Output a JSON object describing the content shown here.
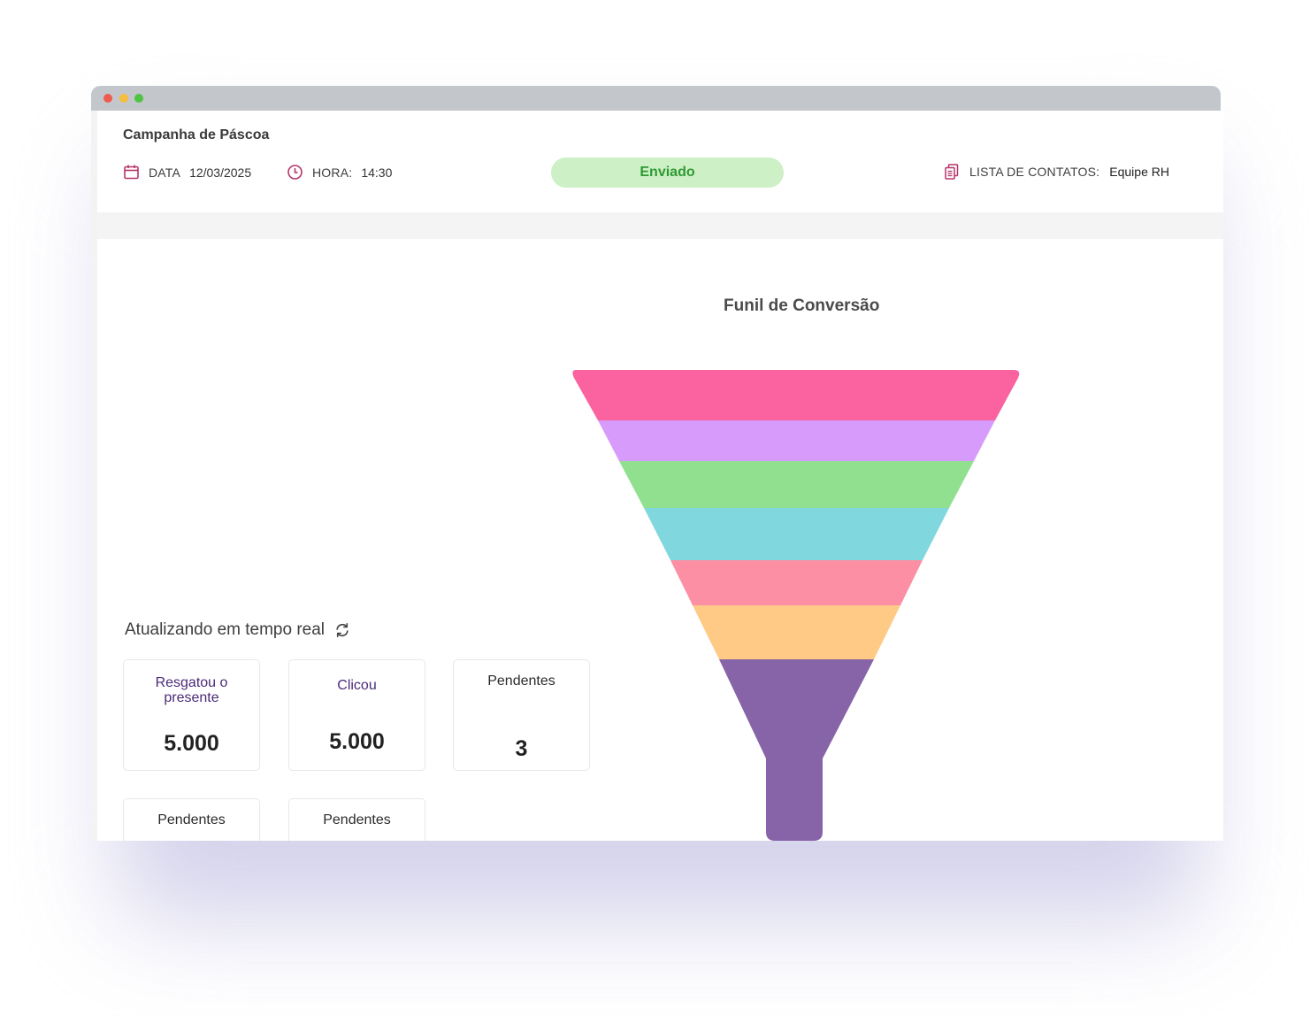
{
  "header": {
    "campaign_title": "Campanha de Páscoa",
    "date_label": "DATA",
    "date_value": "12/03/2025",
    "time_label": "HORA:",
    "time_value": "14:30",
    "status": "Enviado",
    "contacts_label": "LISTA DE CONTATOS:",
    "contacts_value": "Equipe RH"
  },
  "funnel": {
    "title": "Funil de Conversão",
    "stage_colors": [
      "#fb62a0",
      "#d79cfb",
      "#91e090",
      "#80d8de",
      "#fd8fa4",
      "#feca86",
      "#8764a8"
    ]
  },
  "realtime": {
    "label": "Atualizando em tempo real"
  },
  "cards": [
    {
      "label": "Resgatou o presente",
      "value": "5.000"
    },
    {
      "label": "Clicou",
      "value": "5.000"
    },
    {
      "label": "Pendentes",
      "value": "3"
    },
    {
      "label": "Pendentes",
      "value": ""
    },
    {
      "label": "Pendentes",
      "value": ""
    }
  ],
  "colors": {
    "accent": "#b5356b",
    "status_bg": "#cdf0c6",
    "status_text": "#2f9a32"
  }
}
